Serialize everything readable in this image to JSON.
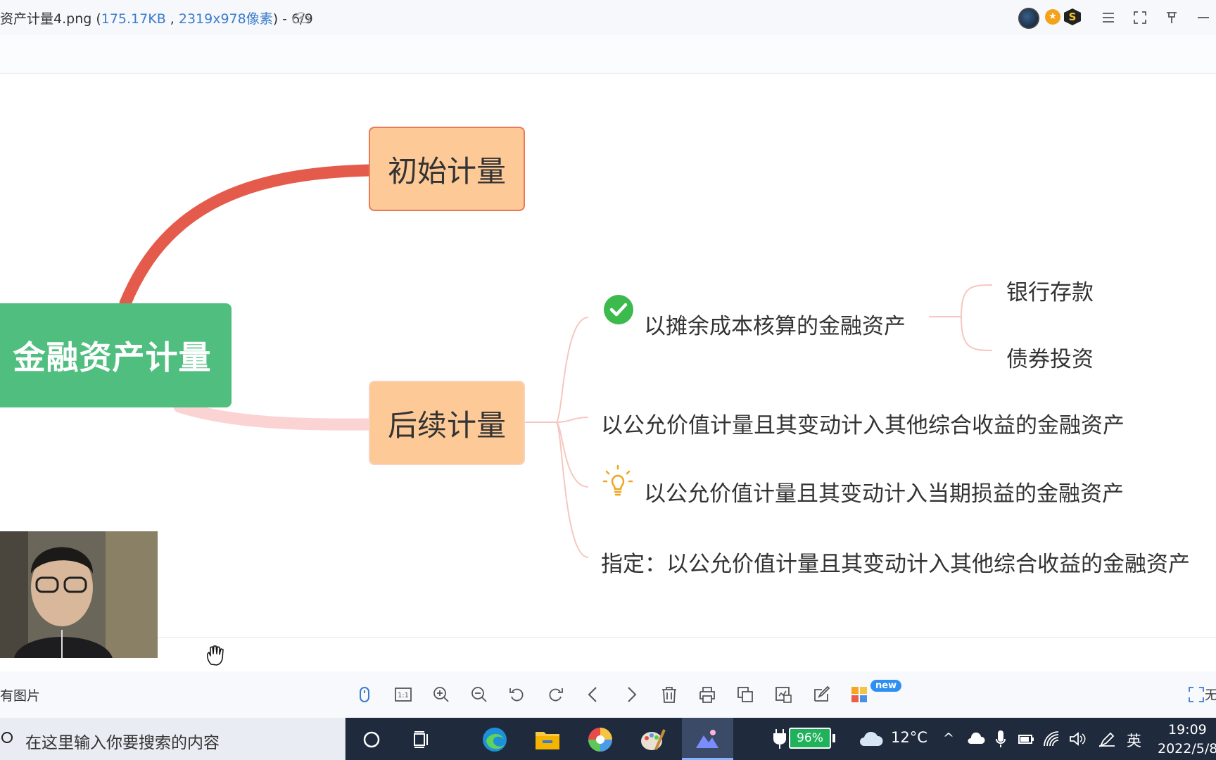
{
  "window": {
    "title_prefix": "资产计量4.png (",
    "file_size": "175.17KB",
    "separator": " , ",
    "dimensions": "2319x978像素",
    "title_suffix": ") - 6/9"
  },
  "mindmap": {
    "root": "金融资产计量",
    "branch_initial": "初始计量",
    "branch_subsequent": "后续计量",
    "leaf_amortized": "以摊余成本核算的金融资产",
    "leaf_bank": "银行存款",
    "leaf_bond": "债券投资",
    "leaf_oci": "以公允价值计量且其变动计入其他综合收益的金融资产",
    "leaf_pl": "以公允价值计量且其变动计入当期损益的金融资产",
    "leaf_designated": "指定：以公允价值计量且其变动计入其他综合收益的金融资产",
    "colors": {
      "root": "#4fbe7f",
      "branch": "#fdc997",
      "line_initial": "#e45b4b",
      "line_subsequent": "#fbd3d3"
    }
  },
  "toolbar": {
    "all_pictures": "有图片",
    "new_badge": "new",
    "fit_label": "无",
    "icons": [
      "mouse-icon",
      "actual-size-icon",
      "zoom-in-icon",
      "zoom-out-icon",
      "rotate-left-icon",
      "rotate-right-icon",
      "previous-icon",
      "next-icon",
      "delete-icon",
      "print-icon",
      "convert-icon",
      "extract-icon",
      "edit-icon",
      "apps-icon"
    ]
  },
  "taskbar": {
    "search_placeholder": "在这里输入你要搜索的内容",
    "battery": "96%",
    "temperature": "12°C",
    "ime": "英",
    "time": "19:09",
    "date": "2022/5/8"
  }
}
